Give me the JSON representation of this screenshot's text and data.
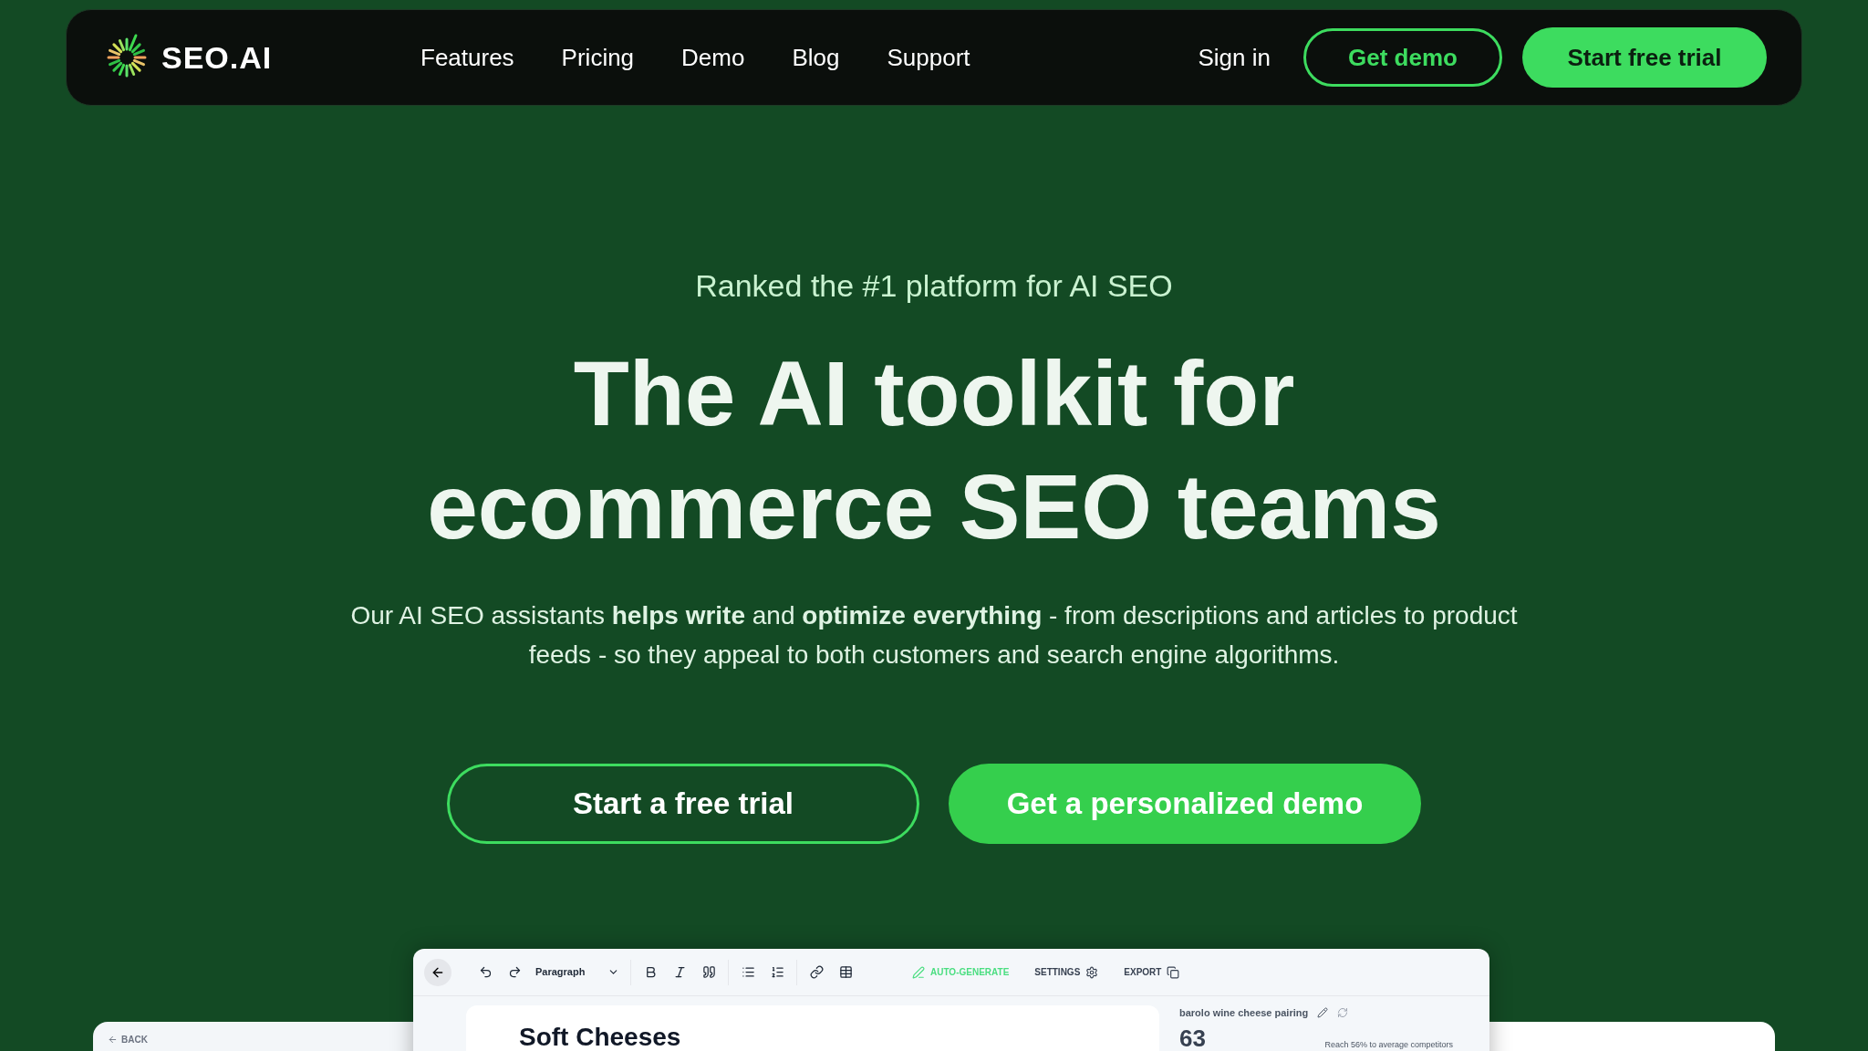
{
  "nav": {
    "logo": "SEO.AI",
    "links": [
      "Features",
      "Pricing",
      "Demo",
      "Blog",
      "Support"
    ],
    "sign_in": "Sign in",
    "get_demo": "Get demo",
    "start_trial": "Start free trial"
  },
  "hero": {
    "tagline": "Ranked the #1 platform for AI SEO",
    "headline": [
      "The AI toolkit for",
      "ecommerce SEO teams"
    ],
    "description": "Our AI SEO assistants **helps write** and **optimize everything** - from descriptions and articles to product feeds - so they appeal to both customers and search engine algorithms.",
    "primary_button": "Start a free trial",
    "secondary_button": "Get a personalized demo"
  },
  "app_preview": {
    "back": "BACK",
    "block_style": "Paragraph",
    "auto_generate": "AUTO-GENERATE",
    "settings": "SETTINGS",
    "export": "EXPORT",
    "document_title": "Soft Cheeses",
    "keyword": "barolo wine cheese pairing",
    "score": "63",
    "score_note": "Reach 56% to average competitors"
  }
}
